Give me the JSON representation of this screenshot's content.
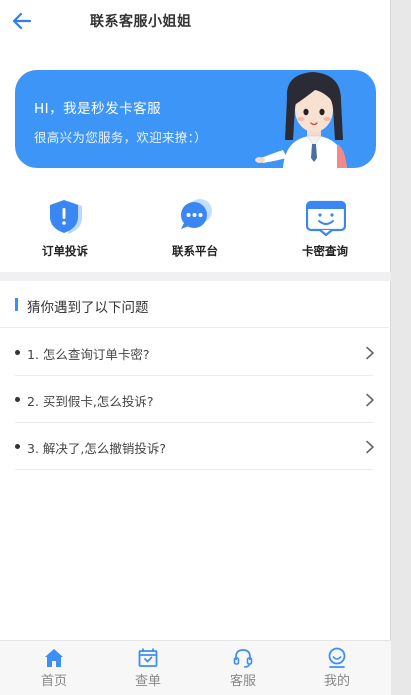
{
  "header": {
    "title": "联系客服小姐姐"
  },
  "banner": {
    "line1": "HI，我是秒发卡客服",
    "line2": "很高兴为您服务，欢迎来撩：）"
  },
  "quick_actions": [
    {
      "label": "订单投诉",
      "icon": "shield-alert-icon"
    },
    {
      "label": "联系平台",
      "icon": "chat-bubble-icon"
    },
    {
      "label": "卡密查询",
      "icon": "message-box-smile-icon"
    }
  ],
  "faq": {
    "title": "猜你遇到了以下问题",
    "items": [
      "1. 怎么查询订单卡密?",
      "2. 买到假卡,怎么投诉?",
      "3. 解决了,怎么撤销投诉?"
    ]
  },
  "tabs": [
    {
      "label": "首页",
      "icon": "home-icon"
    },
    {
      "label": "查单",
      "icon": "order-box-icon"
    },
    {
      "label": "客服",
      "icon": "headset-icon"
    },
    {
      "label": "我的",
      "icon": "user-smile-icon"
    }
  ],
  "colors": {
    "accent": "#3d95f8",
    "tab_active": "#3d8ef5",
    "tab_text": "#888888"
  }
}
